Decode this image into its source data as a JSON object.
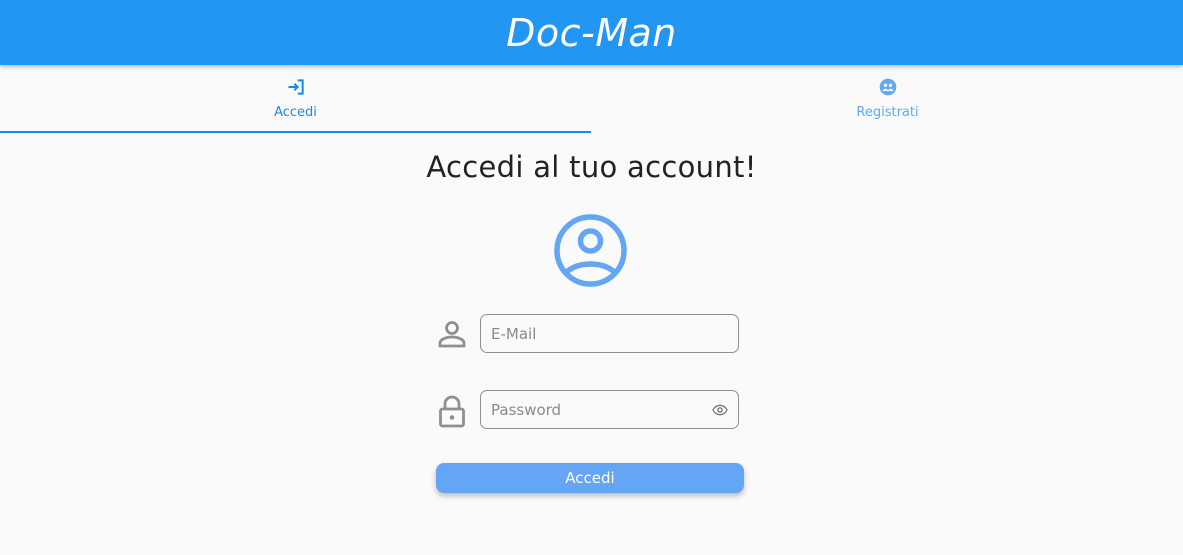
{
  "app": {
    "title": "Doc-Man"
  },
  "tabs": [
    {
      "label": "Accedi",
      "icon": "login-icon",
      "active": true
    },
    {
      "label": "Registrati",
      "icon": "group-add-icon",
      "active": false
    }
  ],
  "login": {
    "heading": "Accedi al tuo account!",
    "avatar_icon": "account-circle-icon",
    "email": {
      "placeholder": "E-Mail",
      "value": "",
      "icon": "person-icon"
    },
    "password": {
      "placeholder": "Password",
      "value": "",
      "icon": "lock-icon",
      "toggle_icon": "eye-icon"
    },
    "submit_label": "Accedi"
  },
  "colors": {
    "primary": "#2196f3",
    "accent": "#1e88e5",
    "button": "#64a5f5",
    "background": "#fafafa"
  }
}
